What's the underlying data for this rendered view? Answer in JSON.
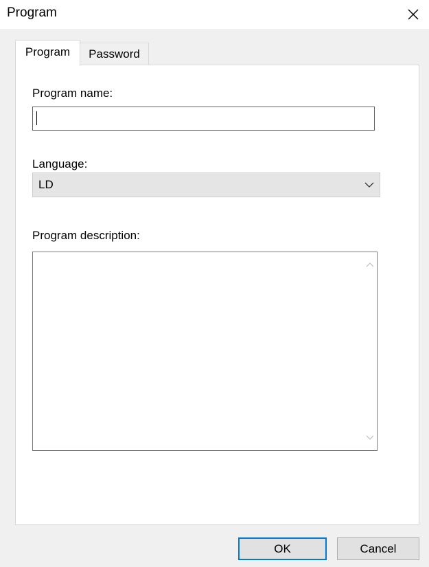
{
  "window": {
    "title": "Program",
    "close_icon": "close-icon"
  },
  "tabs": [
    {
      "label": "Program",
      "active": true
    },
    {
      "label": "Password",
      "active": false
    }
  ],
  "form": {
    "program_name_label": "Program name:",
    "program_name_value": "",
    "language_label": "Language:",
    "language_value": "LD",
    "description_label": "Program description:",
    "description_value": ""
  },
  "buttons": {
    "ok_label": "OK",
    "cancel_label": "Cancel"
  },
  "colors": {
    "focus_accent": "#0078d7",
    "dialog_bg": "#f0f0f0"
  }
}
